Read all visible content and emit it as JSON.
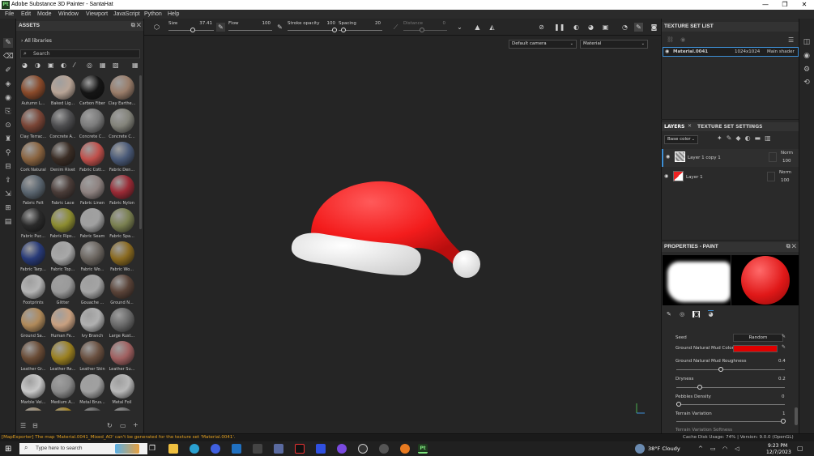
{
  "window": {
    "app_icon": "Pt",
    "title": "Adobe Substance 3D Painter - SantaHat",
    "controls": [
      "—",
      "❐",
      "✕"
    ]
  },
  "menu": [
    "File",
    "Edit",
    "Mode",
    "Window",
    "Viewport",
    "JavaScript",
    "Python",
    "Help"
  ],
  "assets": {
    "title": "ASSETS",
    "library": "All libraries",
    "search_placeholder": "Search",
    "materials": [
      {
        "label": "Autumn L...",
        "color": "#8a4a2a"
      },
      {
        "label": "Baked Lig...",
        "color": "#b8a496"
      },
      {
        "label": "Carbon Fiber",
        "color": "#151515"
      },
      {
        "label": "Clay Earthe...",
        "color": "#9a7d6a"
      },
      {
        "label": "Clay Terrac...",
        "color": "#7a4536"
      },
      {
        "label": "Concrete A...",
        "color": "#4e4e50"
      },
      {
        "label": "Concrete C...",
        "color": "#7b7b7b"
      },
      {
        "label": "Concrete C...",
        "color": "#83837a"
      },
      {
        "label": "Cork Natural",
        "color": "#8a6440"
      },
      {
        "label": "Denim Rivet",
        "color": "#3a2d25"
      },
      {
        "label": "Fabric Cott...",
        "color": "#c0504b"
      },
      {
        "label": "Fabric Den...",
        "color": "#4a5a78"
      },
      {
        "label": "Fabric Felt",
        "color": "#5b6670"
      },
      {
        "label": "Fabric Lace",
        "color": "#4a3c38"
      },
      {
        "label": "Fabric Linen",
        "color": "#8e8280"
      },
      {
        "label": "Fabric Nylon",
        "color": "#9a2a35"
      },
      {
        "label": "Fabric Puc...",
        "color": "#2a2a2a"
      },
      {
        "label": "Fabric Rips...",
        "color": "#8c8c30"
      },
      {
        "label": "Fabric Seam",
        "color": "#a0a0a0"
      },
      {
        "label": "Fabric Spa...",
        "color": "#7a8050"
      },
      {
        "label": "Fabric Tarp...",
        "color": "#283a78"
      },
      {
        "label": "Fabric Top...",
        "color": "#a8a8a8"
      },
      {
        "label": "Fabric Wo...",
        "color": "#6c6660"
      },
      {
        "label": "Fabric Wo...",
        "color": "#8a6a20"
      },
      {
        "label": "Footprints",
        "color": "#b4b4b4"
      },
      {
        "label": "Glitter",
        "color": "#9a9a9a"
      },
      {
        "label": "Gouache ...",
        "color": "#a4a4a4"
      },
      {
        "label": "Ground N...",
        "color": "#5a4338"
      },
      {
        "label": "Ground Sa...",
        "color": "#b08a5a"
      },
      {
        "label": "Human Fe...",
        "color": "#c8a080"
      },
      {
        "label": "Ivy Branch",
        "color": "#b0b0b0"
      },
      {
        "label": "Large Rust...",
        "color": "#6a6a6a"
      },
      {
        "label": "Leather Gr...",
        "color": "#6a4c36"
      },
      {
        "label": "Leather Re...",
        "color": "#9a8020"
      },
      {
        "label": "Leather Skin",
        "color": "#6a5040"
      },
      {
        "label": "Leather Su...",
        "color": "#a06060"
      },
      {
        "label": "Marble Vei...",
        "color": "#c8c8c8"
      },
      {
        "label": "Medium A...",
        "color": "#8a8a8a"
      },
      {
        "label": "Metal Brus...",
        "color": "#a0a0a0"
      },
      {
        "label": "Metal Foil",
        "color": "#b8b8b8"
      },
      {
        "label": "",
        "color": "#9a8a70"
      },
      {
        "label": "",
        "color": "#a08020"
      },
      {
        "label": "",
        "color": "#5a5a5a"
      },
      {
        "label": "",
        "color": "#6a6a6a"
      }
    ]
  },
  "toolbar": {
    "size_label": "Size",
    "size_value": "37.41",
    "flow_label": "Flow",
    "flow_value": "100",
    "stroke_label": "Stroke opacity",
    "stroke_value": "100",
    "spacing_label": "Spacing",
    "spacing_value": "20",
    "distance_label": "Distance",
    "distance_value": "0"
  },
  "viewport": {
    "camera": "Default camera",
    "channel": "Material"
  },
  "texture_set_list": {
    "title": "TEXTURE SET LIST",
    "name": "Material.0041",
    "resolution": "1024x1024",
    "shader": "Main shader"
  },
  "layers": {
    "tab1": "LAYERS",
    "tab2": "TEXTURE SET SETTINGS",
    "channel": "Base color",
    "items": [
      {
        "name": "Layer 1 copy 1",
        "blend": "Norm",
        "opacity": "100"
      },
      {
        "name": "Layer 1",
        "blend": "Norm",
        "opacity": "100"
      }
    ]
  },
  "properties": {
    "title": "PROPERTIES - PAINT",
    "seed_label": "Seed",
    "seed_button": "Random",
    "mud_color_label": "Ground Natural Mud Color",
    "mud_color": "#e00000",
    "roughness_label": "Ground Natural Mud Roughness",
    "roughness_value": "0.4",
    "dryness_label": "Dryness",
    "dryness_value": "0.2",
    "pebbles_label": "Pebbles Density",
    "pebbles_value": "0",
    "terrain_label": "Terrain Variation",
    "terrain_value": "1",
    "terrain2_label": "Terrain Variation Softness"
  },
  "status": {
    "message": "[MapExporter] The map 'Material.0041_Mixed_AO' can't be generated for the texture set 'Material.0041'.",
    "info": "Cache Disk Usage:   74% | Version: 9.0.0 (OpenGL)"
  },
  "taskbar": {
    "search_placeholder": "Type here to search",
    "weather": "38°F  Cloudy",
    "time": "9:23 PM",
    "date": "12/7/2023",
    "active_app": "Pt"
  },
  "colors": {
    "hat_red": "#ff2a2a",
    "hat_white": "#f0f0f0",
    "accent_blue": "#3d8fd6"
  }
}
